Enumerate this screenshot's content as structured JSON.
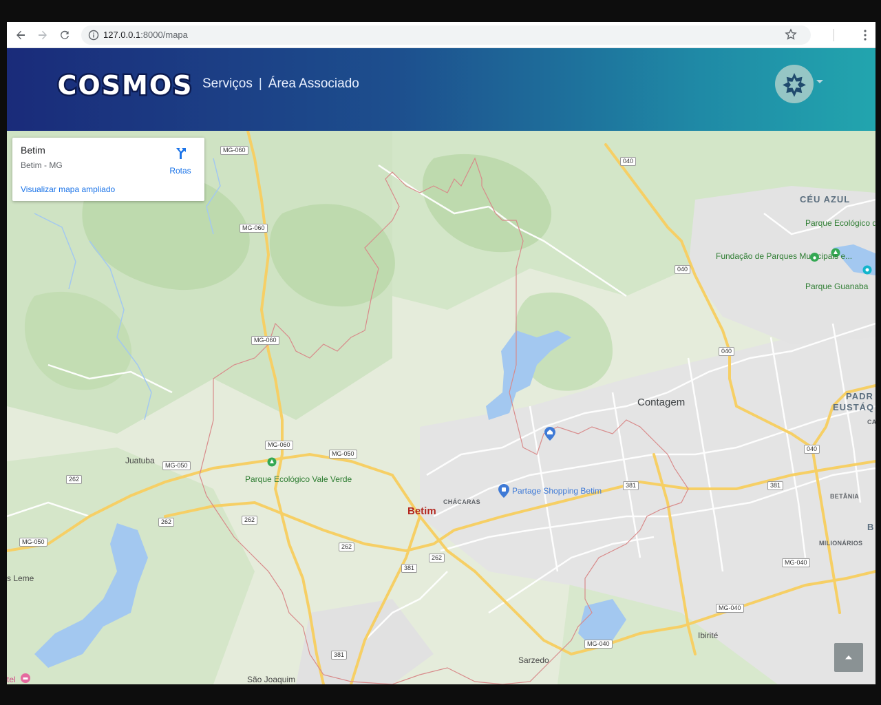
{
  "browser": {
    "url_host": "127.0.0.1",
    "url_path": ":8000/mapa"
  },
  "header": {
    "logo_text": "COSMOS",
    "nav": [
      "Serviços",
      "Área Associado"
    ]
  },
  "place_card": {
    "title": "Betim",
    "address": "Betim - MG",
    "link": "Visualizar mapa ampliado",
    "directions_label": "Rotas"
  },
  "map": {
    "cities": [
      "Contagem",
      "Juatuba",
      "Ibirité",
      "Sarzedo",
      "São Joaquim",
      "s Leme"
    ],
    "focus_city": "Betim",
    "districts": [
      "CÉU AZUL",
      "PADR",
      "EUSTÁQ"
    ],
    "small_labels": [
      "CHÁCARAS",
      "BETÂNIA",
      "MILIONÁRIOS",
      "CA",
      "B"
    ],
    "parks": [
      {
        "name": "Parque Ecológico Vale Verde"
      },
      {
        "name": "Parque Ecológico da Pampulha"
      },
      {
        "name": "Fundação de Parques Municipais e..."
      },
      {
        "name": "Parque Guanaba"
      }
    ],
    "pois": [
      "Partage Shopping Betim",
      "tel"
    ],
    "shields": [
      "MG-060",
      "MG-060",
      "MG-060",
      "MG-060",
      "040",
      "040",
      "040",
      "040",
      "MG-050",
      "MG-050",
      "MG-050",
      "262",
      "262",
      "262",
      "262",
      "262",
      "381",
      "381",
      "381",
      "381",
      "MG-040",
      "MG-040",
      "MG-040"
    ]
  },
  "colors": {
    "header_gradient_start": "#1a2b7a",
    "header_gradient_end": "#22a5ae",
    "link_blue": "#1a73e8",
    "highway_yellow": "#f6cf65",
    "boundary_red": "#d88a8a"
  }
}
